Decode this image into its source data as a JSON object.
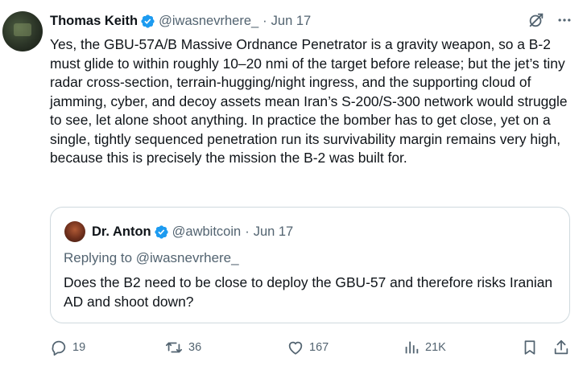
{
  "tweet": {
    "author_name": "Thomas Keith",
    "author_handle": "@iwasnevrhere_",
    "separator": "·",
    "date": "Jun 17",
    "text": "Yes, the GBU-57A/B Massive Ordnance Penetrator is a gravity weapon, so a B-2 must glide to within roughly 10–20 nmi of the target before release; but the jet’s tiny radar cross-section, terrain-hugging/night ingress, and the supporting cloud of jamming, cyber, and decoy assets mean Iran’s S-200/S-300 network would struggle to see, let alone shoot anything. In practice the bomber has to get close, yet on a single, tightly sequenced penetration run its survivability margin remains very high, because this is precisely the mission the B-2 was built for."
  },
  "quoted_tweet": {
    "author_name": "Dr. Anton",
    "author_handle": "@awbitcoin",
    "separator": "·",
    "date": "Jun 17",
    "replying_to": "Replying to @iwasnevrhere_",
    "text": "Does the B2 need to be close to deploy the GBU-57 and therefore risks Iranian AD and shoot down?"
  },
  "actions": {
    "replies": "19",
    "reposts": "36",
    "likes": "167",
    "views": "21K"
  },
  "colors": {
    "verified_blue": "#1d9bf0",
    "muted_text": "#536471",
    "border": "#cfd9de"
  },
  "icons": [
    "verified-badge-icon",
    "grok-icon",
    "more-icon",
    "reply-icon",
    "repost-icon",
    "like-icon",
    "views-icon",
    "bookmark-icon",
    "share-icon"
  ]
}
